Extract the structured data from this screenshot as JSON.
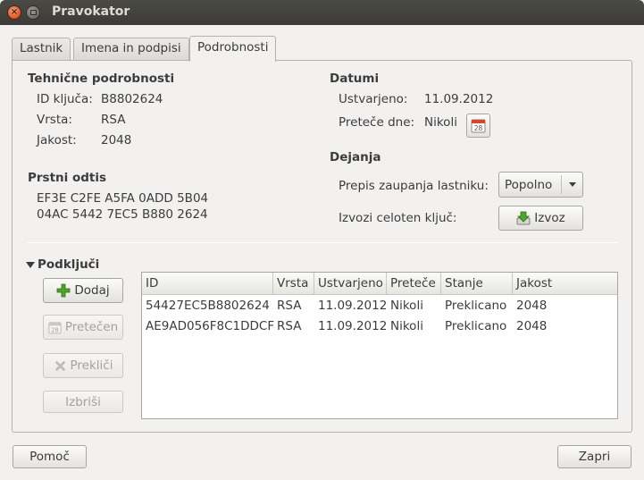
{
  "window": {
    "title": "Pravokator"
  },
  "tabs": [
    "Lastnik",
    "Imena in podpisi",
    "Podrobnosti"
  ],
  "technical": {
    "heading": "Tehnične podrobnosti",
    "rows": [
      {
        "label": "ID ključa:",
        "value": "B8802624"
      },
      {
        "label": "Vrsta:",
        "value": "RSA"
      },
      {
        "label": "Jakost:",
        "value": "2048"
      }
    ]
  },
  "fingerprint": {
    "heading": "Prstni odtis",
    "line1": "EF3E C2FE A5FA 0ADD 5B04",
    "line2": "04AC 5442 7EC5 B880 2624"
  },
  "dates": {
    "heading": "Datumi",
    "created_label": "Ustvarjeno:",
    "created_value": "11.09.2012",
    "expires_label": "Preteče dne:",
    "expires_value": "Nikoli",
    "calendar_icon_text": "28"
  },
  "actions": {
    "heading": "Dejanja",
    "trust_label": "Prepis zaupanja lastniku:",
    "trust_value": "Popolno",
    "export_label": "Izvozi celoten ključ:",
    "export_button": "Izvoz"
  },
  "subkeys": {
    "heading": "Podključi",
    "buttons": {
      "add": "Dodaj",
      "expired": "Pretečen",
      "revoke": "Prekliči",
      "delete": "Izbriši"
    },
    "columns": [
      "ID",
      "Vrsta",
      "Ustvarjeno",
      "Preteče",
      "Stanje",
      "Jakost"
    ],
    "rows": [
      [
        "54427EC5B8802624",
        "RSA",
        "11.09.2012",
        "Nikoli",
        "Preklicano",
        "2048"
      ],
      [
        "AE9AD056F8C1DDCF",
        "RSA",
        "11.09.2012",
        "Nikoli",
        "Preklicano",
        "2048"
      ]
    ]
  },
  "footer": {
    "help": "Pomoč",
    "close": "Zapri"
  },
  "colors": {
    "accent_green": "#4fa52a",
    "calendar_red": "#d9452b"
  }
}
